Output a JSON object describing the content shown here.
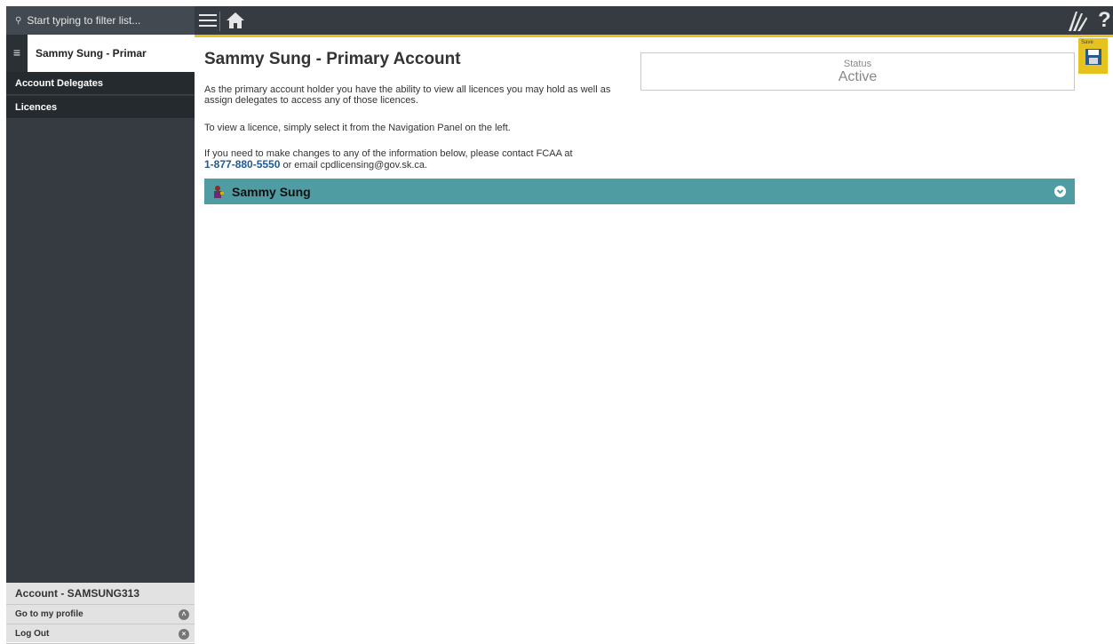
{
  "sidebar": {
    "filter_placeholder": "Start typing to filter list...",
    "account_tab_label": "Sammy Sung - Primar",
    "items": [
      {
        "label": "Account Delegates"
      },
      {
        "label": "Licences"
      }
    ],
    "bottom": {
      "account_label": "Account - SAMSUNG313",
      "profile_link": "Go to my profile",
      "logout_link": "Log Out"
    }
  },
  "topbar": {
    "help_label": "?"
  },
  "main": {
    "title": "Sammy Sung - Primary Account",
    "para1": "As the primary account holder you have the ability to view all licences you may hold as well as assign delegates to access any of those licences.",
    "para2": "To view a licence, simply select it from the Navigation Panel on the left.",
    "para3_prefix": "If you need to make changes to any of the information below, please contact FCAA at",
    "phone": "1-877-880-5550",
    "para3_suffix": " or email cpdlicensing@gov.sk.ca.",
    "status": {
      "label": "Status",
      "value": "Active"
    },
    "save_label": "Save",
    "contact_name": "Sammy Sung"
  },
  "colors": {
    "sidebar_bg": "#353b41",
    "accent_yellow": "#e6c21e",
    "contact_bar": "#4f9ca3",
    "link_blue": "#1e5a96"
  },
  "icons": [
    "search-icon",
    "account-list-icon",
    "menu-icon",
    "home-icon",
    "saskatchewan-logo-icon",
    "help-icon",
    "save-icon",
    "person-icon",
    "chevron-down-icon",
    "chevron-up-icon",
    "close-icon"
  ]
}
